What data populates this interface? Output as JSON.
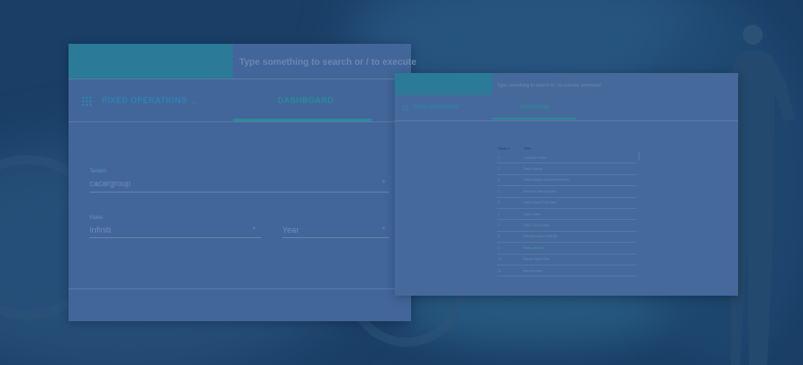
{
  "left_panel": {
    "search_placeholder": "Type something to search or / to execute",
    "nav_title": "FIXED OPERATIONS",
    "tab_label": "DASHBOARD",
    "fields": {
      "tenant_label": "Tenant",
      "tenant_value": "cacargroup",
      "make_label": "Make",
      "make_value": "Infiniti",
      "year_placeholder": "Year"
    }
  },
  "right_panel": {
    "search_placeholder": "Type something to search or / to execute command",
    "nav_title": "FIXED OPERATIONS",
    "tab_label": "DASHBOARD",
    "table": {
      "headers": [
        "Rank #",
        "Title"
      ],
      "rows": [
        [
          "1",
          "Customer Lines"
        ],
        [
          "2",
          "Parts Markup"
        ],
        [
          "3",
          "Parts Markup Goal Achievement"
        ],
        [
          "4",
          "Revenue Warranty Rev"
        ],
        [
          "5",
          "Parts Gross Profit Mark"
        ],
        [
          "6",
          "Labor Sales"
        ],
        [
          "7",
          "Parts Gross Sales"
        ],
        [
          "8",
          "Effective Labor Rate ($)"
        ],
        [
          "9",
          "Parts Labor $"
        ],
        [
          "10",
          "Repair Order Rate"
        ],
        [
          "11",
          "Service Lines"
        ]
      ]
    }
  },
  "icons": {
    "apps_grid": "apps-grid-icon",
    "chevron": "chevron-down-icon",
    "caret": "dropdown-caret-icon"
  },
  "colors": {
    "background": "#1a3e66",
    "panel": "#42669a",
    "accent_teal": "#2a7a98",
    "accent_blue": "#2d82b2"
  }
}
